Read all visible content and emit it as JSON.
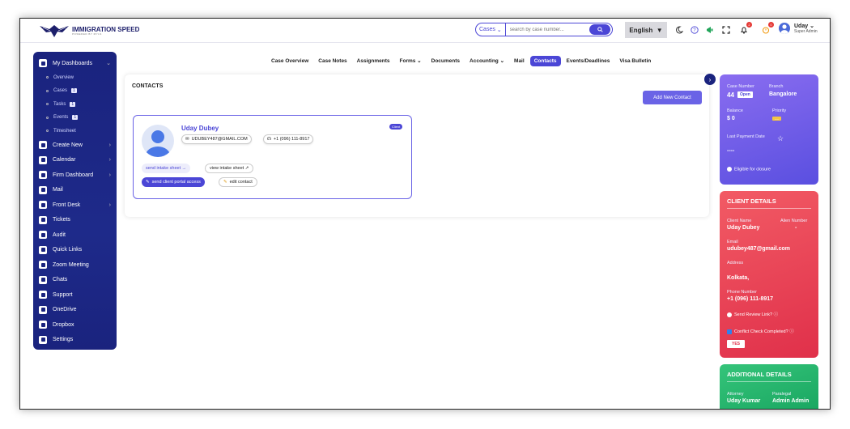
{
  "header": {
    "logo_title": "IMMIGRATION SPEED",
    "logo_sub": "POWERED BY MYLS",
    "search_select": "Cases",
    "search_placeholder": "search by case number...",
    "language": "English",
    "notif_count_1": "2",
    "notif_count_2": "0",
    "user_name": "Uday",
    "user_role": "Super Admin"
  },
  "sidebar": {
    "dashboards": "My Dashboards",
    "sub_items": [
      {
        "label": "Overview",
        "count": ""
      },
      {
        "label": "Cases",
        "count": "1"
      },
      {
        "label": "Tasks",
        "count": "1"
      },
      {
        "label": "Events",
        "count": "1"
      },
      {
        "label": "Timesheet",
        "count": ""
      }
    ],
    "items": [
      {
        "label": "Create New",
        "arrow": true
      },
      {
        "label": "Calendar",
        "arrow": true
      },
      {
        "label": "Firm Dashboard",
        "arrow": true
      },
      {
        "label": "Mail",
        "arrow": false
      },
      {
        "label": "Front Desk",
        "arrow": true
      },
      {
        "label": "Tickets",
        "arrow": false
      },
      {
        "label": "Audit",
        "arrow": false
      },
      {
        "label": "Quick Links",
        "arrow": false
      },
      {
        "label": "Zoom Meeting",
        "arrow": false
      },
      {
        "label": "Chats",
        "arrow": false
      },
      {
        "label": "Support",
        "arrow": false
      },
      {
        "label": "OneDrive",
        "arrow": false
      },
      {
        "label": "Dropbox",
        "arrow": false
      },
      {
        "label": "Settings",
        "arrow": false
      }
    ]
  },
  "tabs": [
    {
      "label": "Case Overview",
      "active": false
    },
    {
      "label": "Case Notes",
      "active": false
    },
    {
      "label": "Assignments",
      "active": false
    },
    {
      "label": "Forms ⌄",
      "active": false
    },
    {
      "label": "Documents",
      "active": false
    },
    {
      "label": "Accounting ⌄",
      "active": false
    },
    {
      "label": "Mail",
      "active": false
    },
    {
      "label": "Contacts",
      "active": true
    },
    {
      "label": "Events/Deadlines",
      "active": false
    },
    {
      "label": "Visa Bulletin",
      "active": false
    }
  ],
  "contacts": {
    "title": "CONTACTS",
    "add_button": "Add New Contact",
    "card": {
      "name": "Uday Dubey",
      "email": "UDUBEY487@GMAIL.COM",
      "phone": "+1 (096) 111-8917",
      "badge": "Client",
      "send_intake": "send intake sheet →",
      "view_intake": "view intake sheet ↗",
      "send_portal": "send client portal access",
      "edit_contact": "edit contact"
    }
  },
  "case_panel": {
    "case_number_label": "Case Number",
    "case_number": "44",
    "status": "Open",
    "branch_label": "Branch",
    "branch": "Bangalore",
    "balance_label": "Balance",
    "balance": "$ 0",
    "priority_label": "Priority",
    "priority": "----",
    "last_payment_label": "Last Payment Date",
    "last_payment": "----",
    "eligible_label": "Eligible for closure"
  },
  "client_panel": {
    "title": "CLIENT DETAILS",
    "client_name_label": "Client Name",
    "client_name": "Uday Dubey",
    "alien_label": "Alien Number",
    "alien": "-",
    "email_label": "Email",
    "email": "udubey487@gmail.com",
    "address_label": "Address",
    "address": "Kolkata,",
    "phone_label": "Phone Number",
    "phone": "+1 (096) 111-8917",
    "review_label": "Send Review Link?",
    "conflict_label": "Conflict Check Completed?",
    "yes": "YES"
  },
  "additional_panel": {
    "title": "ADDITIONAL DETAILS",
    "attorney_label": "Attorney",
    "attorney": "Uday Kumar",
    "paralegal_label": "Paralegal",
    "paralegal": "Admin Admin"
  },
  "colors": {
    "accent": "#4b46d6",
    "sidebar": "#1a237e"
  }
}
